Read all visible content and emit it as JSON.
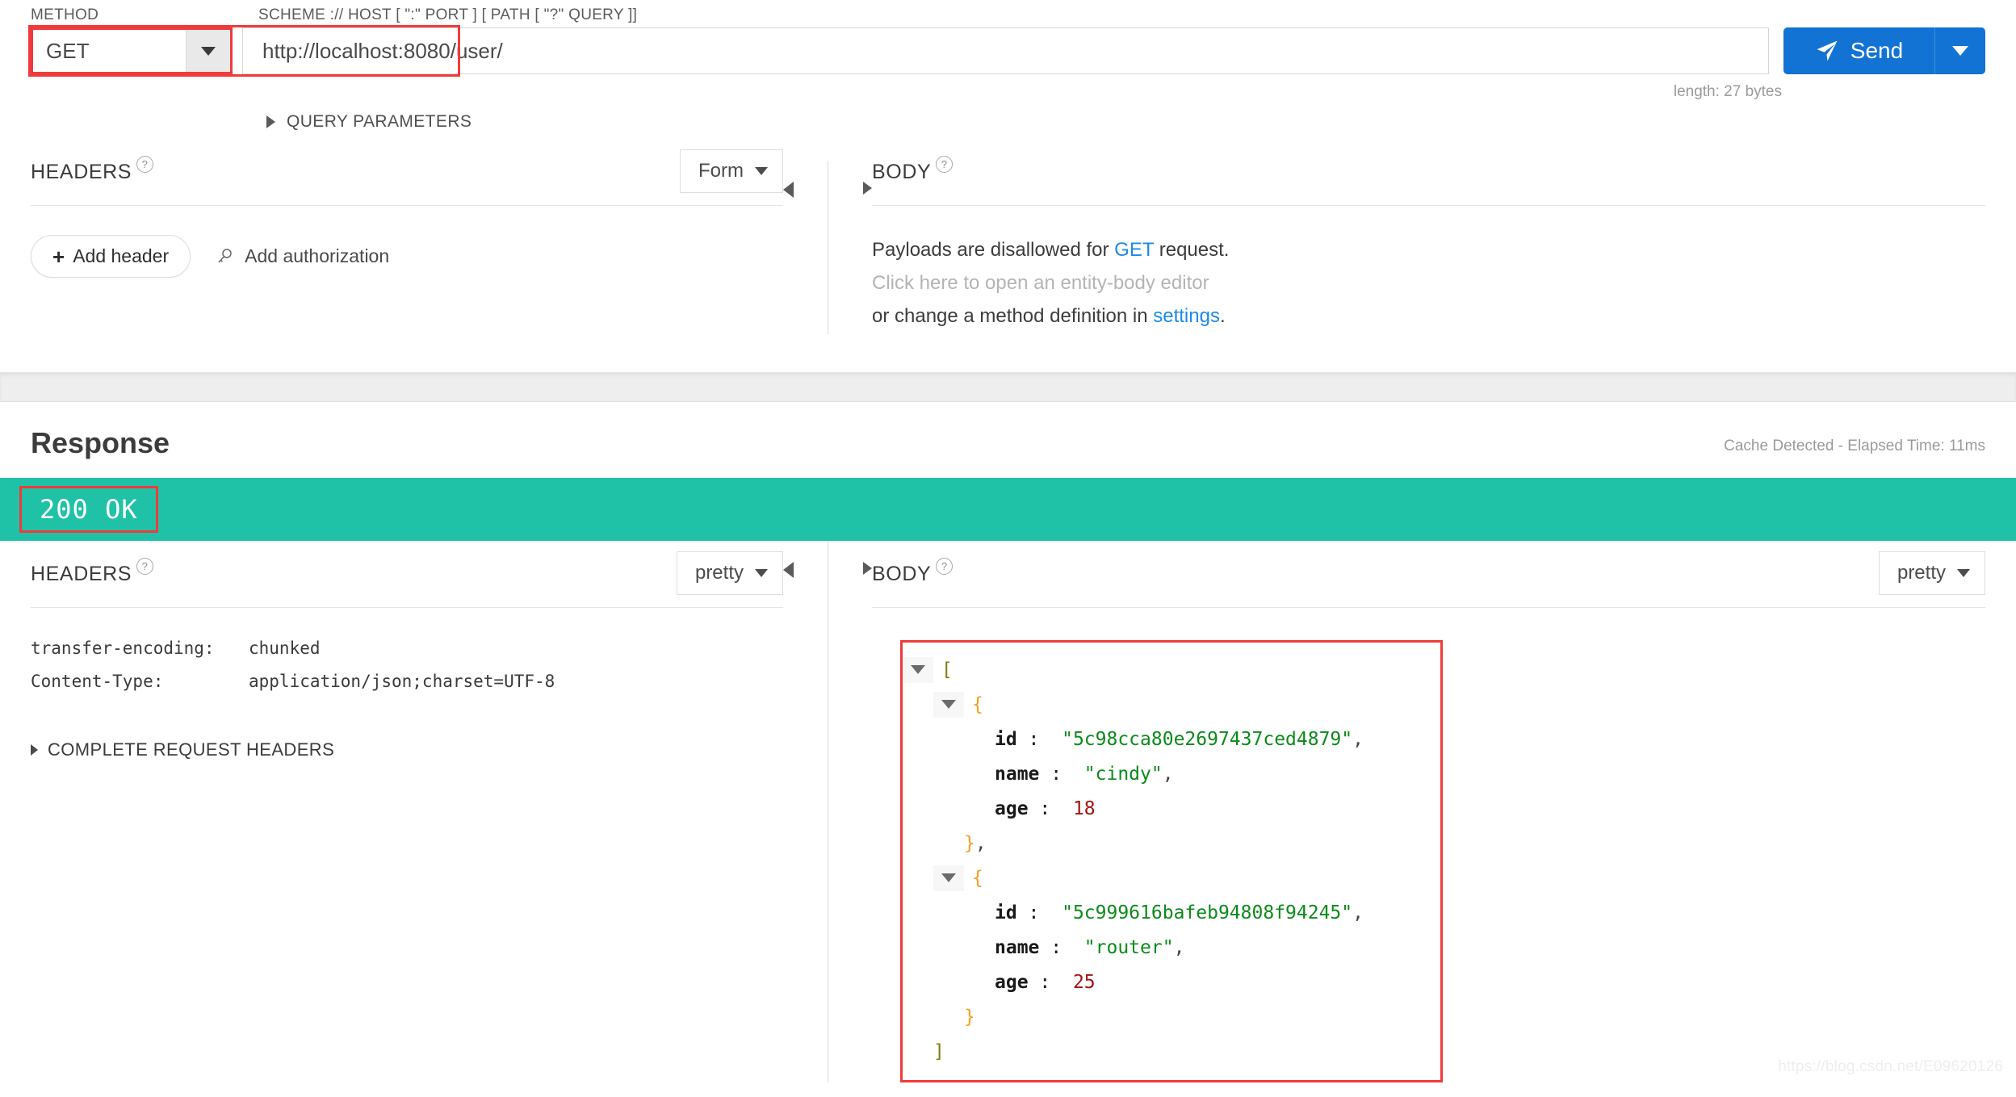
{
  "request": {
    "labels": {
      "method": "METHOD",
      "scheme": "SCHEME :// HOST [ \":\" PORT ] [ PATH [ \"?\" QUERY ]]"
    },
    "method_value": "GET",
    "url_value": "http://localhost:8080/user/",
    "url_placeholder": "http://localhost:8080/user/",
    "send_label": "Send",
    "length_text": "length: 27 bytes",
    "query_parameters_label": "QUERY PARAMETERS",
    "headers": {
      "title": "HEADERS",
      "help": "?",
      "format_select": "Form",
      "add_header_label": "Add header",
      "add_header_plus": "+",
      "add_authorization_label": "Add authorization"
    },
    "body": {
      "title": "BODY",
      "help": "?",
      "line1_pre": "Payloads are disallowed for ",
      "line1_link": "GET",
      "line1_post": " request.",
      "line2": "Click here to open an entity-body editor",
      "line3_pre": "or change a method definition in ",
      "line3_link": "settings",
      "line3_post": "."
    }
  },
  "response": {
    "title": "Response",
    "meta": "Cache Detected - Elapsed Time: 11ms",
    "status_code": "200 OK",
    "status_color": "#1fc2a7",
    "headers": {
      "title": "HEADERS",
      "help": "?",
      "format_select": "pretty",
      "rows": [
        {
          "key": "transfer-encoding:",
          "value": "chunked"
        },
        {
          "key": "Content-Type:",
          "value": "application/json;charset=UTF-8"
        }
      ],
      "complete_request_headers_label": "COMPLETE REQUEST HEADERS"
    },
    "body": {
      "title": "BODY",
      "help": "?",
      "format_select": "pretty",
      "json": [
        {
          "indent": 0,
          "toggle": true,
          "tokens": [
            {
              "t": "bracket",
              "v": "["
            }
          ]
        },
        {
          "indent": 1,
          "toggle": true,
          "tokens": [
            {
              "t": "brace",
              "v": "{"
            }
          ]
        },
        {
          "indent": 2,
          "toggle": false,
          "tokens": [
            {
              "t": "key",
              "v": "id"
            },
            {
              "t": "colon",
              "v": " :"
            },
            {
              "t": "str",
              "v": "  \"5c98cca80e2697437ced4879\""
            },
            {
              "t": "punct",
              "v": ","
            }
          ]
        },
        {
          "indent": 2,
          "toggle": false,
          "tokens": [
            {
              "t": "key",
              "v": "name"
            },
            {
              "t": "colon",
              "v": " :"
            },
            {
              "t": "str",
              "v": "  \"cindy\""
            },
            {
              "t": "punct",
              "v": ","
            }
          ]
        },
        {
          "indent": 2,
          "toggle": false,
          "tokens": [
            {
              "t": "key",
              "v": "age"
            },
            {
              "t": "colon",
              "v": " :"
            },
            {
              "t": "num",
              "v": "  18"
            }
          ]
        },
        {
          "indent": 1,
          "toggle": false,
          "tokens": [
            {
              "t": "brace",
              "v": "}"
            },
            {
              "t": "punct",
              "v": ","
            }
          ]
        },
        {
          "indent": 1,
          "toggle": true,
          "tokens": [
            {
              "t": "brace",
              "v": "{"
            }
          ]
        },
        {
          "indent": 2,
          "toggle": false,
          "tokens": [
            {
              "t": "key",
              "v": "id"
            },
            {
              "t": "colon",
              "v": " :"
            },
            {
              "t": "str",
              "v": "  \"5c999616bafeb94808f94245\""
            },
            {
              "t": "punct",
              "v": ","
            }
          ]
        },
        {
          "indent": 2,
          "toggle": false,
          "tokens": [
            {
              "t": "key",
              "v": "name"
            },
            {
              "t": "colon",
              "v": " :"
            },
            {
              "t": "str",
              "v": "  \"router\""
            },
            {
              "t": "punct",
              "v": ","
            }
          ]
        },
        {
          "indent": 2,
          "toggle": false,
          "tokens": [
            {
              "t": "key",
              "v": "age"
            },
            {
              "t": "colon",
              "v": " :"
            },
            {
              "t": "num",
              "v": "  25"
            }
          ]
        },
        {
          "indent": 1,
          "toggle": false,
          "tokens": [
            {
              "t": "brace",
              "v": "}"
            }
          ]
        },
        {
          "indent": 0,
          "toggle": false,
          "tokens": [
            {
              "t": "bracket",
              "v": "]"
            }
          ]
        }
      ],
      "parsed": [
        {
          "id": "5c98cca80e2697437ced4879",
          "name": "cindy",
          "age": 18
        },
        {
          "id": "5c999616bafeb94808f94245",
          "name": "router",
          "age": 25
        }
      ]
    }
  },
  "watermark": "https://blog.csdn.net/E09620126"
}
